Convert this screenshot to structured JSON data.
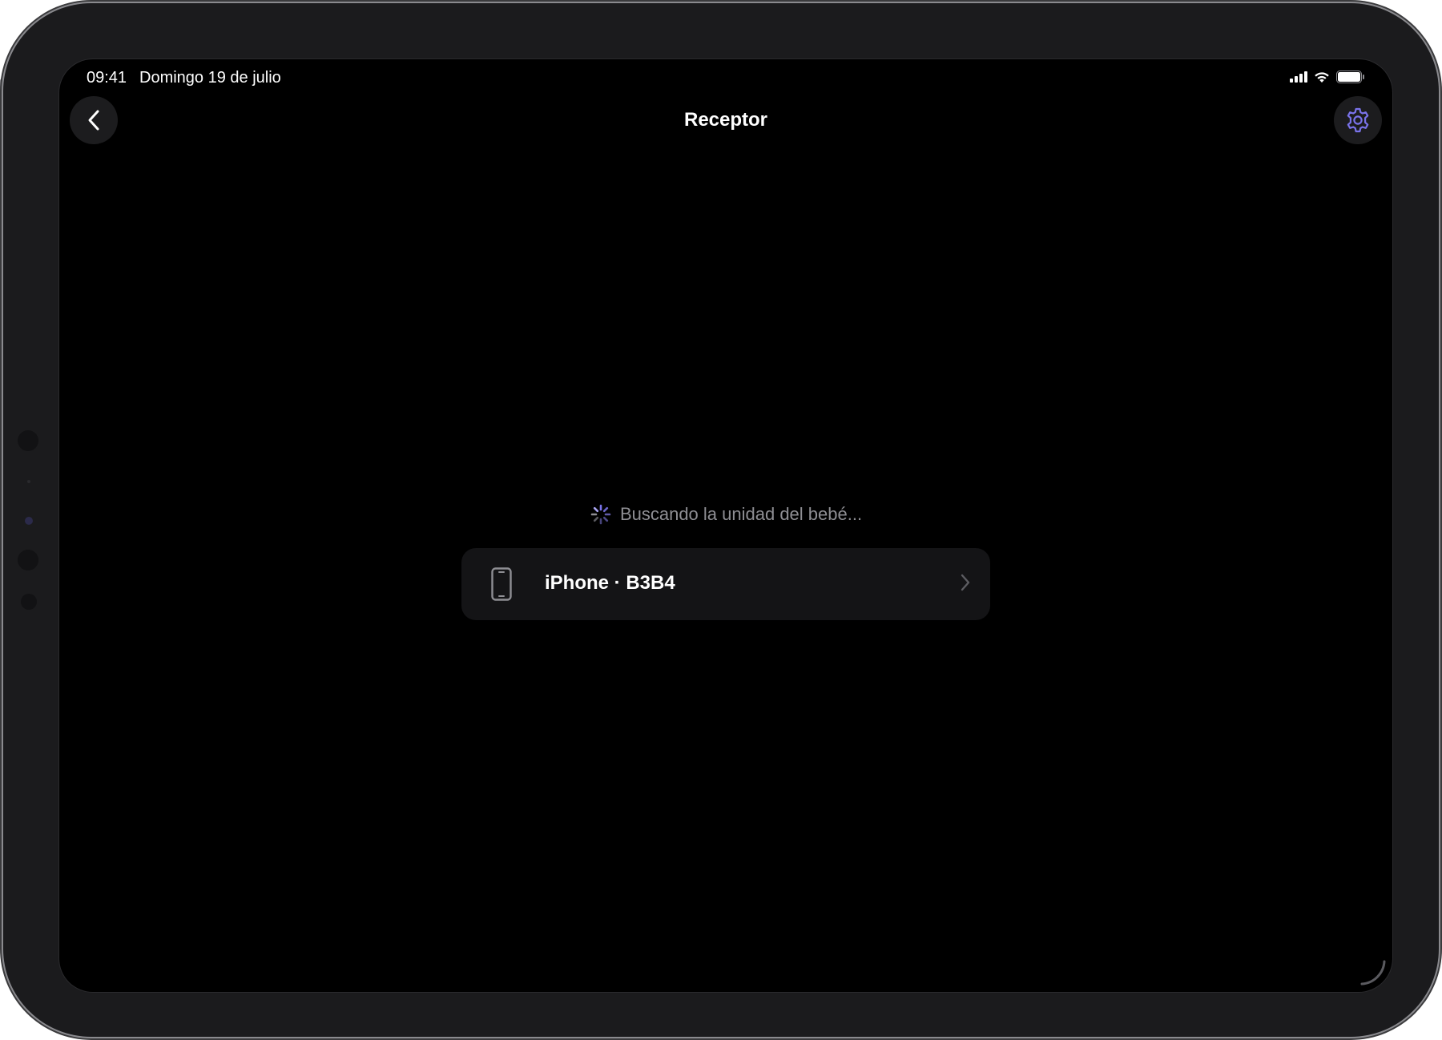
{
  "status_bar": {
    "time": "09:41",
    "date": "Domingo 19 de julio",
    "icons": [
      "cellular-signal-icon",
      "wifi-icon",
      "battery-icon"
    ]
  },
  "nav": {
    "title": "Receptor",
    "back_icon": "chevron-left-icon",
    "settings_icon": "gear-icon"
  },
  "search": {
    "status_text": "Buscando la unidad del bebé...",
    "spinner_icon": "activity-spinner-icon"
  },
  "device_list": [
    {
      "label": "iPhone · B3B4",
      "icon": "iphone-icon",
      "chevron": "chevron-right-icon"
    }
  ],
  "colors": {
    "background": "#000000",
    "row_background": "#141416",
    "accent": "#7a73ea",
    "secondary_text": "#8e8e93",
    "bezel": "#1b1b1d"
  }
}
